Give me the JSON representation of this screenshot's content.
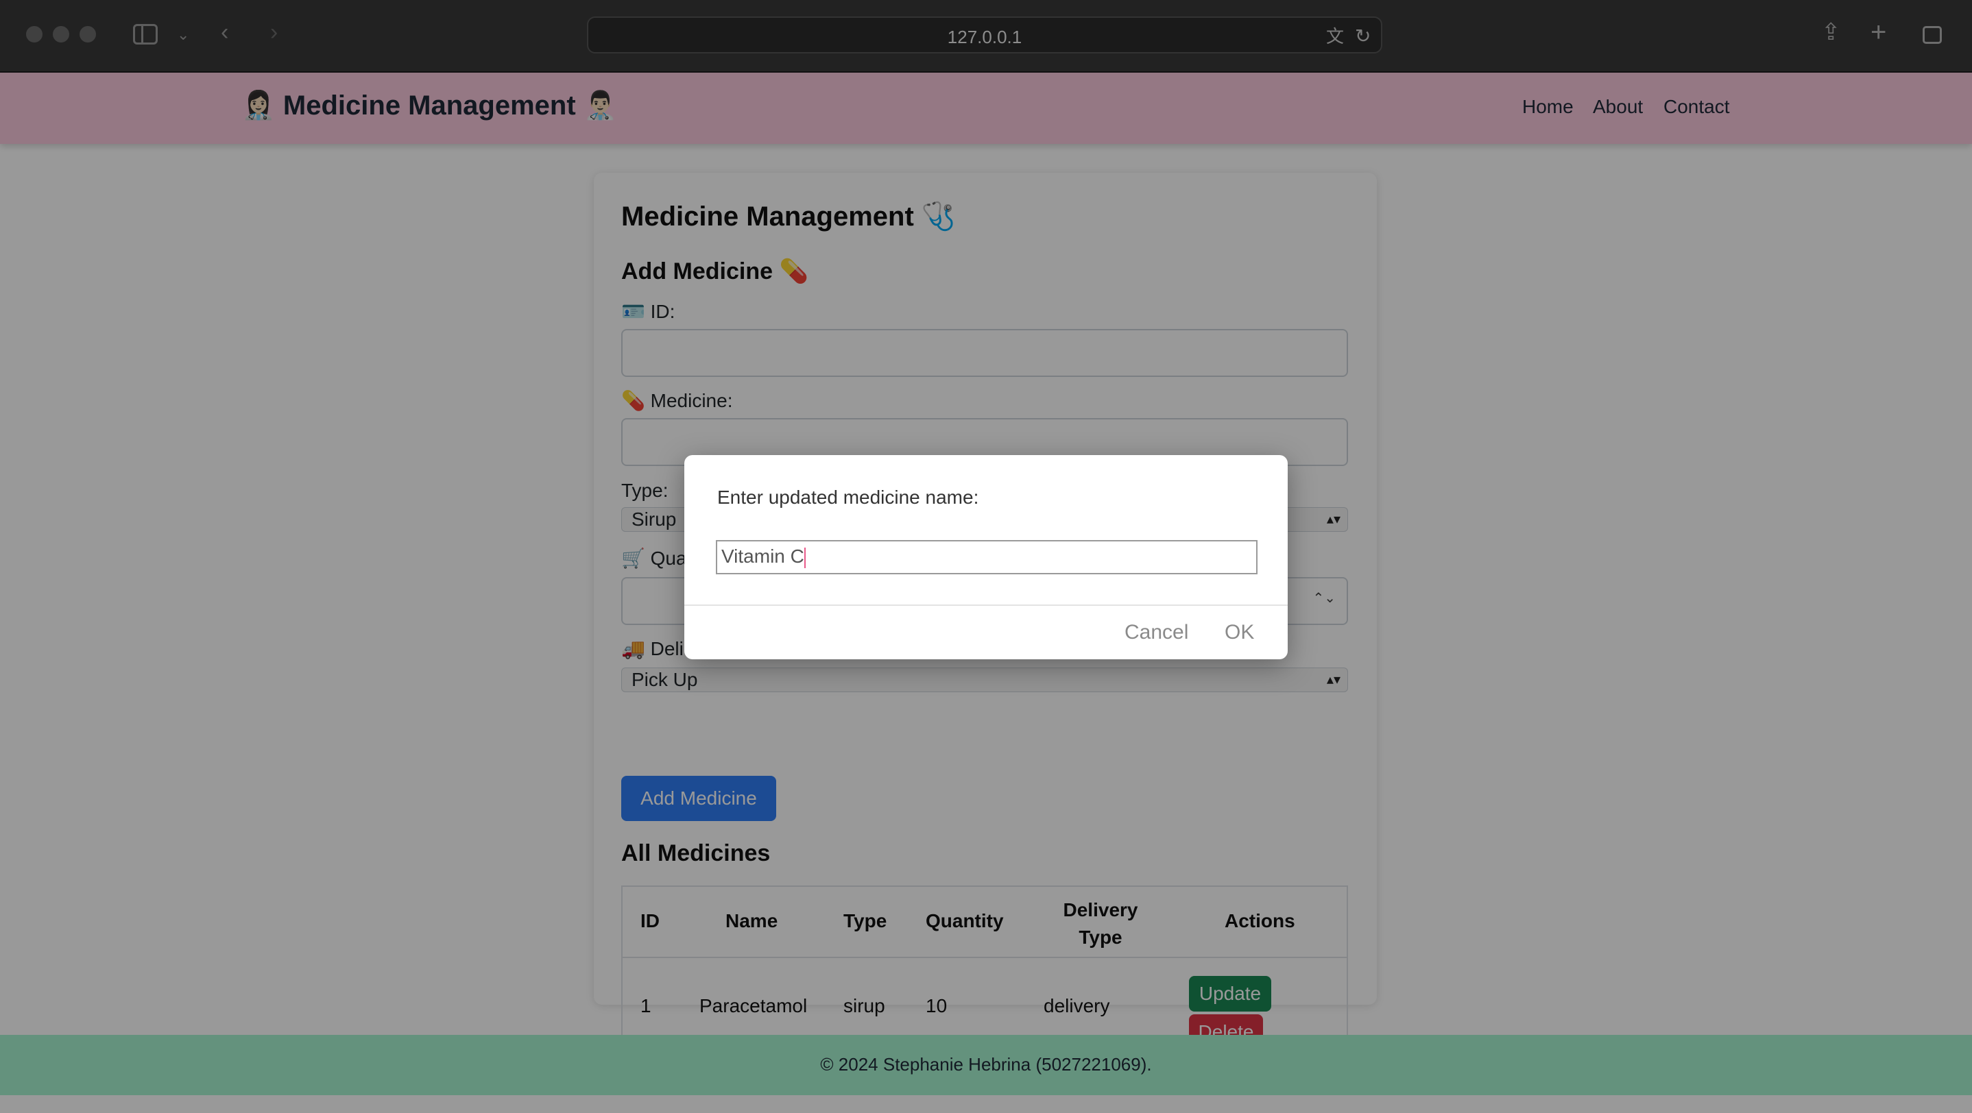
{
  "browser": {
    "url": "127.0.0.1"
  },
  "navbar": {
    "brand": "👩🏻‍⚕️ Medicine Management 👨🏻‍⚕️",
    "links": [
      "Home",
      "About",
      "Contact"
    ]
  },
  "main": {
    "title": "Medicine Management 🩺",
    "form": {
      "heading": "Add Medicine 💊",
      "id_label": "🪪 ID:",
      "medicine_label": "💊 Medicine:",
      "type_label": "Type:",
      "type_value": "Sirup",
      "quantity_label": "🛒 Qua",
      "delivery_label": "🚚 Deli",
      "delivery_value": "Pick Up",
      "submit_label": "Add Medicine"
    },
    "table": {
      "heading": "All Medicines",
      "columns": [
        "ID",
        "Name",
        "Type",
        "Quantity",
        "Delivery Type",
        "Actions"
      ],
      "rows": [
        {
          "id": "1",
          "name": "Paracetamol",
          "type": "sirup",
          "quantity": "10",
          "delivery": "delivery",
          "update_label": "Update",
          "delete_label": "Delete"
        }
      ]
    }
  },
  "footer": {
    "text": "© 2024 Stephanie Hebrina (5027221069)."
  },
  "dialog": {
    "message": "Enter updated medicine name:",
    "input_value": "Vitamin C",
    "cancel_label": "Cancel",
    "ok_label": "OK"
  },
  "colors": {
    "navbar": "#f8c8dc",
    "footer": "#a7f3d0",
    "primary": "#2f7df6",
    "success": "#198754",
    "danger": "#dc3545"
  }
}
